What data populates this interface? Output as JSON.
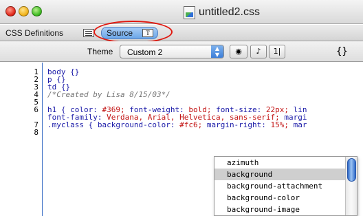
{
  "window": {
    "title": "untitled2.css"
  },
  "tabs": {
    "css_definitions": "CSS Definitions",
    "source": "Source",
    "source_icon": "T"
  },
  "theme": {
    "label": "Theme",
    "selected": "Custom 2",
    "braces": "{}"
  },
  "editor": {
    "line_numbers": [
      "1",
      "2",
      "3",
      "4",
      "5",
      "6",
      "",
      "7",
      "8"
    ],
    "line1": {
      "selector": "body",
      "brace": "{}"
    },
    "line2": {
      "selector": "p",
      "brace": "{}"
    },
    "line3": {
      "selector": "td",
      "brace": "{}"
    },
    "line4": {
      "comment": "/*Created by Lisa 8/15/03*/"
    },
    "line6": {
      "selector": "h1 {",
      "p1": " color:",
      "v1": " #369;",
      "p2": " font-weight:",
      "v2": " bold;",
      "p3": " font-size:",
      "v3": " 22px;",
      "p4": " lin"
    },
    "line6b": {
      "p1": "font-family:",
      "v1": " Verdana, Arial, Helvetica, sans-serif;",
      "p2": " margi"
    },
    "line7": {
      "selector": ".myclass {",
      "p1": " background-color:",
      "v1": " #fc6;",
      "p2": " margin-right:",
      "v2": " 15%;",
      "p3": " mar"
    }
  },
  "autocomplete": {
    "items": [
      "azimuth",
      "background",
      "background-attachment",
      "background-color",
      "background-image"
    ],
    "selected": "background"
  },
  "icons": [
    "close-icon",
    "minimize-icon",
    "zoom-icon",
    "css-file-icon",
    "list-view-icon",
    "text-view-icon",
    "eye-icon",
    "music-note-icon",
    "line-number-icon"
  ],
  "colors": {
    "selection_tab": "#6aa6e8",
    "highlight_ring": "#e0170e",
    "selector_blue": "#1a1aa8",
    "value_red": "#c21212"
  }
}
